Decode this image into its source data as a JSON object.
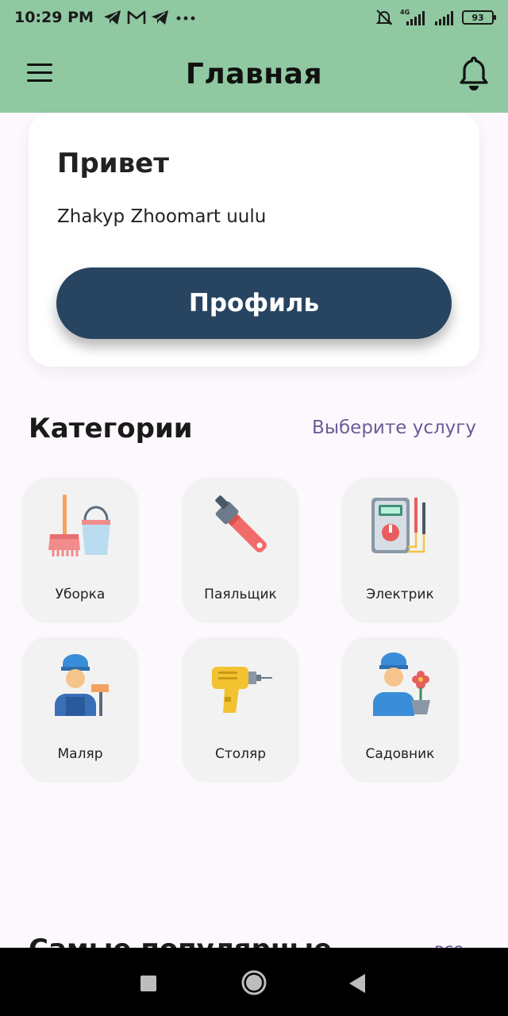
{
  "status_bar": {
    "time": "10:29 PM",
    "battery": "93",
    "icons_left": [
      "telegram-icon",
      "gmail-icon",
      "telegram-icon",
      "more-dots-icon"
    ],
    "icons_right": [
      "bell-off-icon",
      "signal-4g-icon",
      "signal-icon",
      "battery-icon"
    ]
  },
  "app_bar": {
    "title": "Главная",
    "left_icon": "menu-icon",
    "right_icon": "bell-icon",
    "background": "#8fc8a1"
  },
  "greeting": {
    "title": "Привет",
    "name": "Zhakyp Zhoomart uulu",
    "profile_button": "Профиль",
    "button_color": "#274560"
  },
  "categories": {
    "title": "Категории",
    "link": "Выберите услугу",
    "items": [
      {
        "label": "Уборка",
        "icon": "cleaning-icon"
      },
      {
        "label": "Паяльщик",
        "icon": "wrench-icon"
      },
      {
        "label": "Электрик",
        "icon": "multimeter-icon"
      },
      {
        "label": "Маляр",
        "icon": "painter-icon"
      },
      {
        "label": "Столяр",
        "icon": "drill-icon"
      },
      {
        "label": "Садовник",
        "icon": "gardener-icon"
      }
    ]
  },
  "popular": {
    "title": "Самые популярные",
    "link": "все"
  },
  "nav_bar": {
    "icons": [
      "recents-icon",
      "home-icon",
      "back-icon"
    ]
  }
}
